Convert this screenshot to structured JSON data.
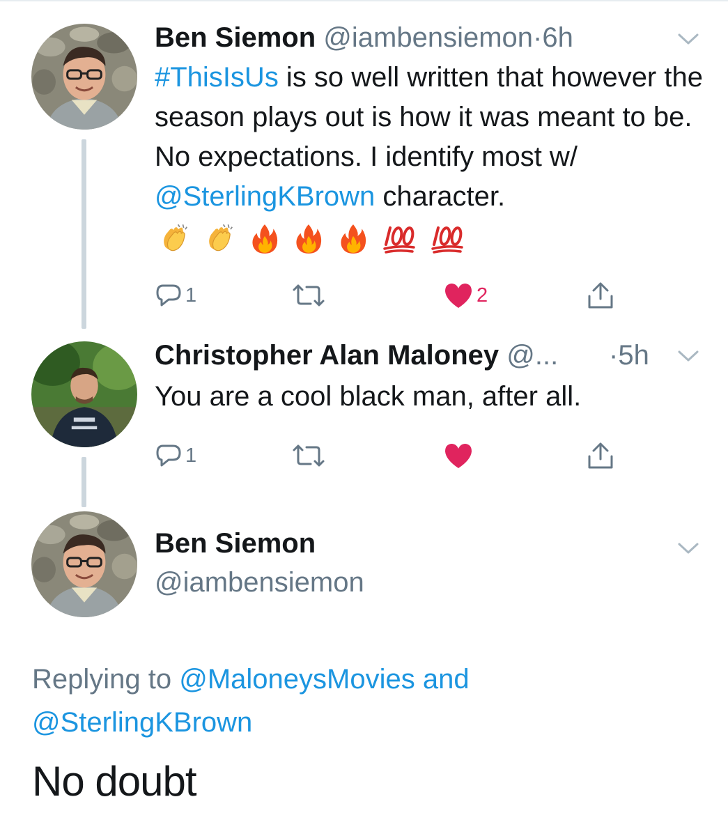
{
  "tweets": [
    {
      "name": "Ben Siemon",
      "handle": "@iambensiemon",
      "dot": "·",
      "time": "6h",
      "text_hashtag": "#ThisIsUs",
      "text_1": " is so well written that however the season plays out is how it was meant to be. No expectations. I identify most w/ ",
      "text_mention": "@SterlingKBrown",
      "text_2": " character.",
      "emoji_names": [
        "clapping-hands-emoji",
        "clapping-hands-emoji",
        "fire-emoji",
        "fire-emoji",
        "fire-emoji",
        "hundred-points-emoji",
        "hundred-points-emoji"
      ],
      "reply_count": "1",
      "retweet_count": "",
      "like_count": "2",
      "liked": true
    },
    {
      "name": "Christopher Alan Maloney",
      "handle": "@...",
      "dot": "·",
      "time": "5h",
      "text": "You are a cool black man, after all.",
      "reply_count": "1",
      "retweet_count": "",
      "like_count": "",
      "liked": true
    }
  ],
  "main_tweet": {
    "name": "Ben Siemon",
    "handle": "@iambensiemon",
    "replying_prefix": "Replying to ",
    "replying_user_1": "@MaloneysMovies",
    "replying_and": " and",
    "replying_user_2": "@SterlingKBrown",
    "text": "No doubt"
  },
  "icons": {
    "reply": "reply-icon",
    "retweet": "retweet-icon",
    "like": "heart-icon",
    "share": "share-icon",
    "more": "chevron-down-icon"
  },
  "colors": {
    "link": "#1b95e0",
    "secondary": "#657786",
    "like": "#e0245e",
    "thread_line": "#ccd6dd",
    "text": "#14171a"
  }
}
